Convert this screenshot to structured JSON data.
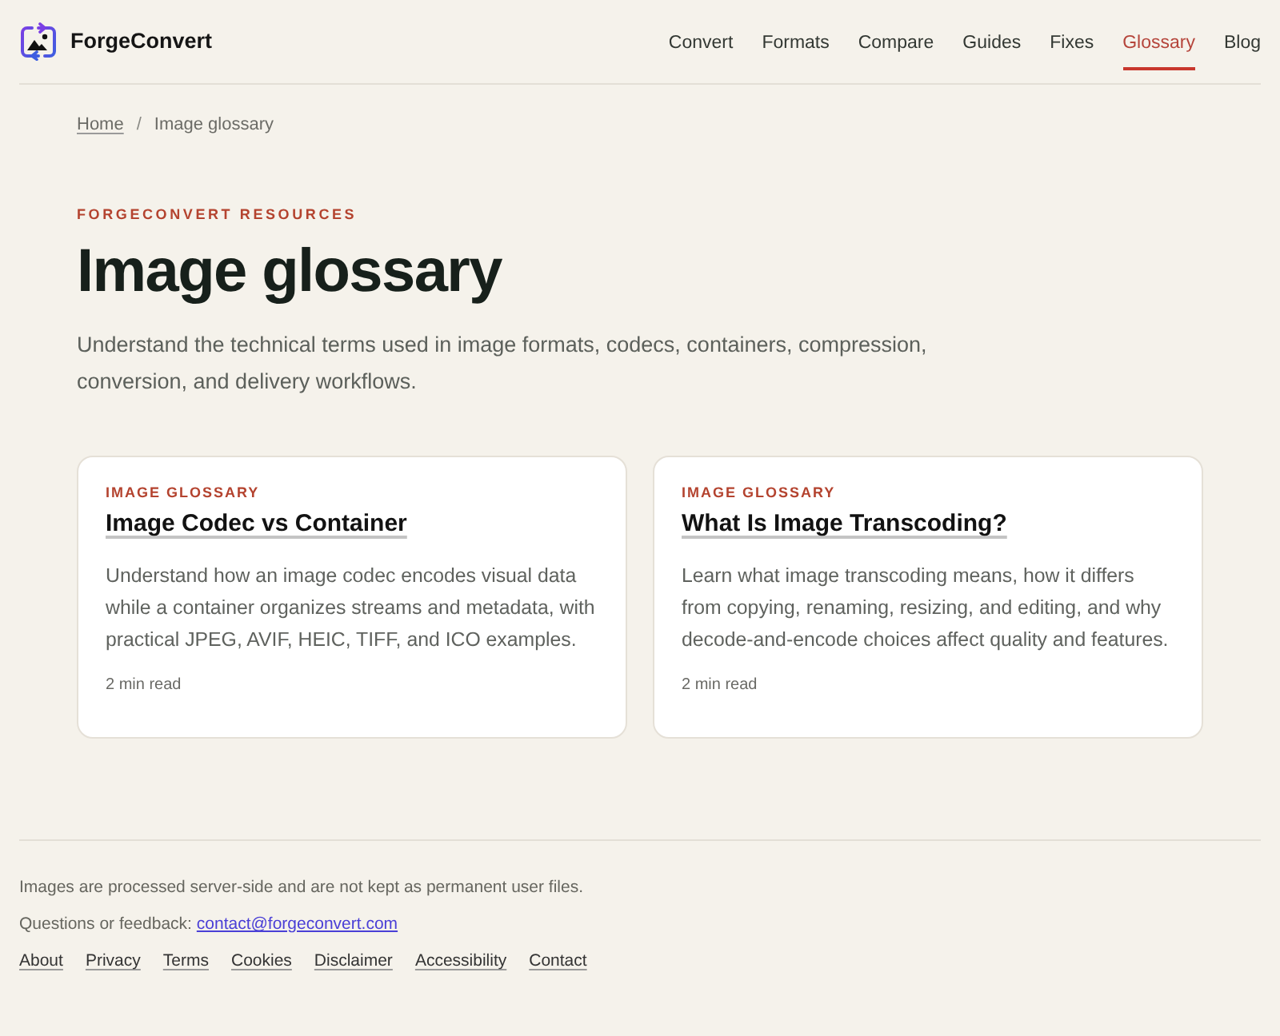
{
  "header": {
    "brand": "ForgeConvert",
    "nav": [
      {
        "label": "Convert",
        "selected": false
      },
      {
        "label": "Formats",
        "selected": false
      },
      {
        "label": "Compare",
        "selected": false
      },
      {
        "label": "Guides",
        "selected": false
      },
      {
        "label": "Fixes",
        "selected": false
      },
      {
        "label": "Glossary",
        "selected": true
      },
      {
        "label": "Blog",
        "selected": false
      }
    ]
  },
  "breadcrumb": {
    "items": [
      {
        "label": "Home",
        "kind": "link"
      },
      {
        "label": "Image glossary",
        "kind": "current"
      }
    ],
    "separator": "/"
  },
  "hero": {
    "eyebrow": "FORGECONVERT RESOURCES",
    "title": "Image glossary",
    "intro": "Understand the technical terms used in image formats, codecs, containers, compression, conversion, and delivery workflows."
  },
  "cards": [
    {
      "eyebrow": "IMAGE GLOSSARY",
      "title": "Image Codec vs Container",
      "summary": "Understand how an image codec encodes visual data while a container organizes streams and metadata, with practical JPEG, AVIF, HEIC, TIFF, and ICO examples.",
      "read_time": "2 min read"
    },
    {
      "eyebrow": "IMAGE GLOSSARY",
      "title": "What Is Image Transcoding?",
      "summary": "Learn what image transcoding means, how it differs from copying, renaming, resizing, and editing, and why decode-and-encode choices affect quality and features.",
      "read_time": "2 min read"
    }
  ],
  "footer": {
    "notice": "Images are processed server-side and are not kept as permanent user files.",
    "contact_label": "Questions or feedback:",
    "contact_email": "contact@forgeconvert.com",
    "links": [
      "About",
      "Privacy",
      "Terms",
      "Cookies",
      "Disclaimer",
      "Accessibility",
      "Contact"
    ]
  }
}
